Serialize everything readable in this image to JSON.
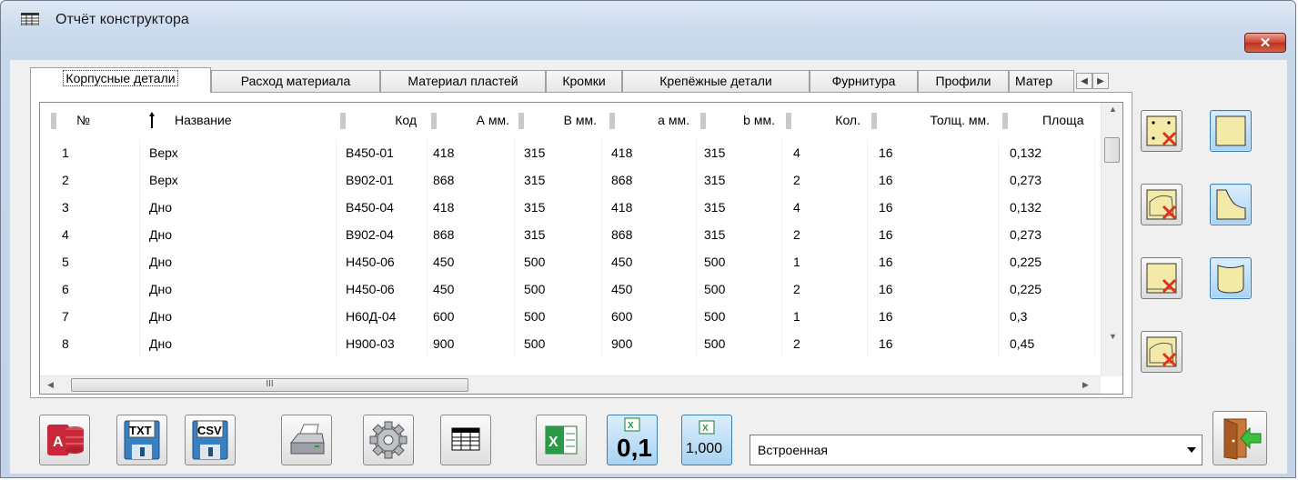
{
  "window": {
    "title": "Отчёт конструктора",
    "close_label": "✕"
  },
  "tabs": [
    {
      "label": "Корпусные детали",
      "active": true
    },
    {
      "label": "Расход материала"
    },
    {
      "label": "Материал пластей"
    },
    {
      "label": "Кромки"
    },
    {
      "label": "Крепёжные детали"
    },
    {
      "label": "Фурнитура"
    },
    {
      "label": "Профили"
    },
    {
      "label": "Матер"
    }
  ],
  "table": {
    "columns": [
      "№",
      "Название",
      "Код",
      "А мм.",
      "В мм.",
      "а мм.",
      "b мм.",
      "Кол.",
      "Толщ. мм.",
      "Площа"
    ],
    "rows": [
      [
        "1",
        "Верх",
        "В450-01",
        "418",
        "315",
        "418",
        "315",
        "4",
        "16",
        "0,132"
      ],
      [
        "2",
        "Верх",
        "В902-01",
        "868",
        "315",
        "868",
        "315",
        "2",
        "16",
        "0,273"
      ],
      [
        "3",
        "Дно",
        "В450-04",
        "418",
        "315",
        "418",
        "315",
        "4",
        "16",
        "0,132"
      ],
      [
        "4",
        "Дно",
        "В902-04",
        "868",
        "315",
        "868",
        "315",
        "2",
        "16",
        "0,273"
      ],
      [
        "5",
        "Дно",
        "Н450-06",
        "450",
        "500",
        "450",
        "500",
        "1",
        "16",
        "0,225"
      ],
      [
        "6",
        "Дно",
        "Н450-06",
        "450",
        "500",
        "450",
        "500",
        "2",
        "16",
        "0,225"
      ],
      [
        "7",
        "Дно",
        "Н60Д-04",
        "600",
        "500",
        "600",
        "500",
        "1",
        "16",
        "0,3"
      ],
      [
        "8",
        "Дно",
        "Н900-03",
        "900",
        "500",
        "900",
        "500",
        "2",
        "16",
        "0,45"
      ]
    ],
    "hscroll_grip": "III"
  },
  "side_buttons": [
    "hole-delete",
    "panel-rect",
    "curve-edge-delete",
    "panel-curved",
    "edge-bottom-delete",
    "panel-cylinder",
    "arc-edge-delete"
  ],
  "toolbar": {
    "txt_label": "TXT",
    "csv_label": "CSV",
    "precision_label_1": "0,1",
    "precision_label_2": "1,000",
    "dropdown_value": "Встроенная"
  }
}
